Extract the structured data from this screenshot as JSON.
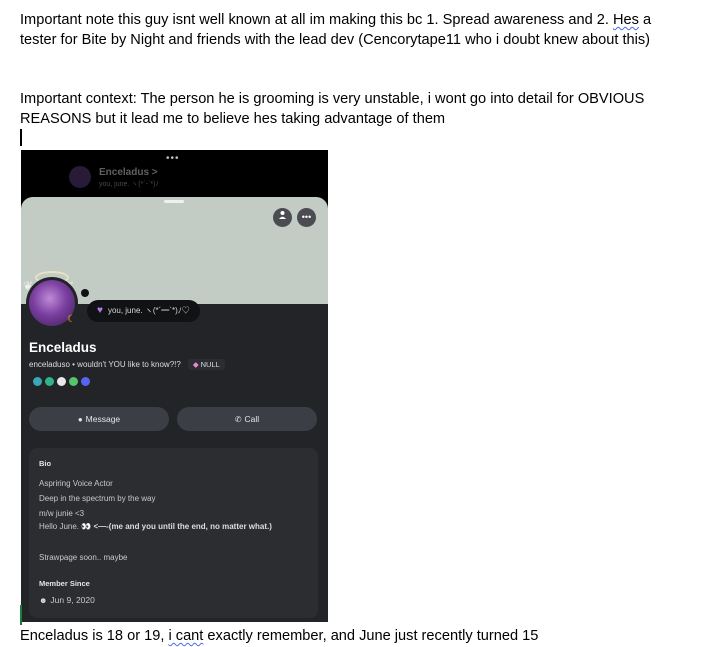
{
  "document": {
    "para1_a": "Important note this guy isnt well known at all im making this bc 1. Spread awareness and 2. ",
    "para1_hes": "Hes",
    "para1_b": " a tester for Bite by Night and friends with the lead dev (Cencorytape11 who i doubt knew about this)",
    "para2": "Important context: The person he is grooming is very unstable, i wont go into detail for OBVIOUS REASONS but it lead me to believe hes taking advantage of them",
    "para3_a": "Enceladus is 18 or 19, ",
    "para3_icant": "i cant",
    "para3_b": " exactly remember, and June just recently turned 15"
  },
  "profile": {
    "bg_header_name": "Enceladus >",
    "bg_header_status": "you, june. ヽ(*´-`*)ﾉ",
    "status": "you, june. ヽ(*´━`*)ﾉ♡",
    "display_name": "Enceladus",
    "username_line": "enceladuso • wouldn't YOU like to know?!?",
    "tag": "NULL",
    "message_button": "Message",
    "call_button": "Call",
    "bio_heading": "Bio",
    "bio_lines": [
      "Aspriring Voice Actor",
      "Deep in the spectrum by the way",
      "m/w junie <3"
    ],
    "bio_hello": "Hello June. 👀",
    "bio_hello_bold": " <—-(me and you until the end, no matter what.)",
    "bio_last": "Strawpage soon.. maybe",
    "member_heading": "Member Since",
    "member_date": "Jun 9, 2020"
  },
  "colors": {
    "banner": "#c3ccc4",
    "sheet": "#232428",
    "card": "#2b2d31",
    "button": "#3c3e45",
    "heart": "#b57bee",
    "badges": [
      "#3aa7b5",
      "#2fb38a",
      "#e8e8e8",
      "#55c46a",
      "#5865f2"
    ]
  },
  "icons": [
    "more-dots-icon",
    "add-friend-icon",
    "more-options-icon",
    "heart-icon",
    "gem-icon",
    "message-icon",
    "phone-icon",
    "discord-icon"
  ]
}
